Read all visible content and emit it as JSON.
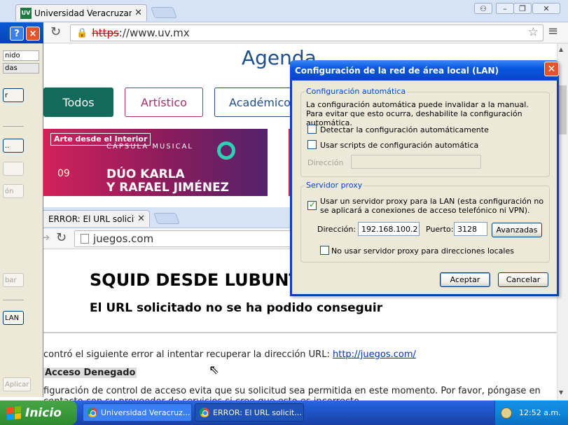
{
  "chrome1": {
    "tab_title": "Universidad Veracruzana",
    "favicon_text": "UV",
    "url_scheme": "https",
    "url_rest": "://www.uv.mx",
    "agenda_title": "Agenda",
    "filters": [
      "Todos",
      "Artístico",
      "Académico"
    ],
    "banner": {
      "tag": "Arte desde el Interior",
      "caption": "CÁPSULA MUSICAL",
      "date": "09",
      "line1": "DÚO KARLA",
      "line2": "Y RAFAEL JIMÉNEZ"
    }
  },
  "options_panel": {
    "help": "?",
    "close": "×",
    "items": [
      "nido",
      "das"
    ],
    "buttons": [
      "r",
      "",
      "..",
      "",
      "ón",
      "bar",
      "LAN",
      "Aplicar"
    ]
  },
  "chrome2": {
    "tab_title": "ERROR: El URL solicitado no",
    "url": "juegos.com",
    "heading": "SQUID DESDE LUBUNTU",
    "subheading": "El URL solicitado no se ha podido conseguir",
    "error_text": "contró el siguiente error al intentar recuperar la dirección URL:",
    "error_link": "http://juegos.com/",
    "denied_label": "Acceso Denegado",
    "policy_line1": "figuración de control de acceso evita que su solicitud sea permitida en este momento. Por favor, póngase en",
    "policy_line2": "contacto con su proveedor de servicios si cree que esto es incorrecto."
  },
  "lan_dialog": {
    "title": "Configuración de la red de área local (LAN)",
    "auto_group": "Configuración automática",
    "auto_desc": "La configuración automática puede invalidar a la manual. Para evitar que esto ocurra, deshabilite la configuración automática.",
    "detect_label": "Detectar la configuración automáticamente",
    "detect_checked": false,
    "script_label": "Usar scripts de configuración automática",
    "script_checked": false,
    "address_label": "Dirección",
    "address_value": "",
    "proxy_group": "Servidor proxy",
    "use_proxy_label": "Usar un servidor proxy para la LAN (esta configuración no se aplicará a conexiones de acceso telefónico ni VPN).",
    "use_proxy_checked": true,
    "proxy_address_label": "Dirección:",
    "proxy_address_value": "192.168.100.2",
    "port_label": "Puerto:",
    "port_value": "3128",
    "advanced_label": "Avanzadas",
    "bypass_label": "No usar servidor proxy para direcciones locales",
    "bypass_checked": false,
    "ok_label": "Aceptar",
    "cancel_label": "Cancelar"
  },
  "taskbar": {
    "start_label": "Inicio",
    "tasks": [
      "Universidad Veracruz...",
      "ERROR: El URL solicit..."
    ],
    "clock": "12:52 a.m."
  },
  "colors": {
    "xp_blue": "#0841b8",
    "uv_green": "#1a7a42",
    "filter_todos": "#116a5a",
    "filter_artistico": "#a3316f",
    "filter_academico": "#1f4f8a"
  }
}
